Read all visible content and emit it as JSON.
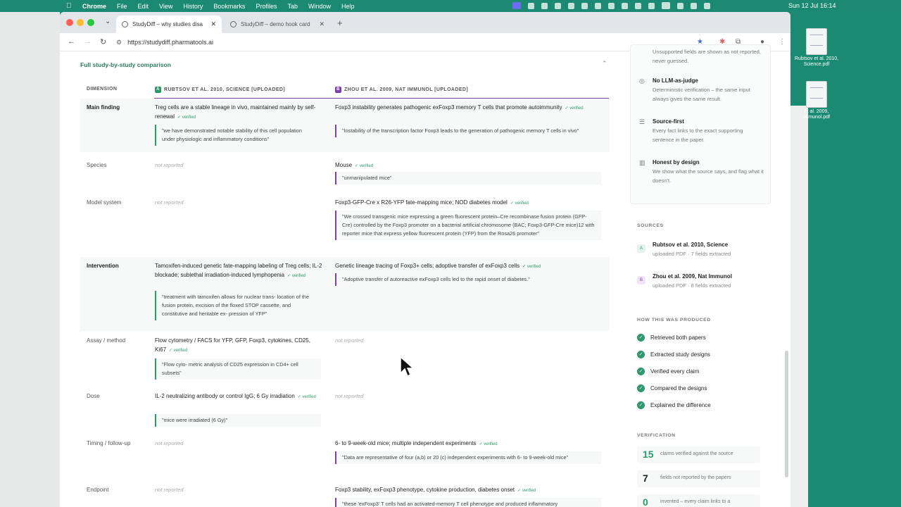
{
  "menubar": {
    "apple": "",
    "app_name": "Chrome",
    "menus": [
      "File",
      "Edit",
      "View",
      "History",
      "Bookmarks",
      "Profiles",
      "Tab",
      "Window",
      "Help"
    ],
    "clock": "Sun 12 Jul 16:14"
  },
  "desktop": {
    "files": [
      {
        "label": "Rubtsov et al. 2010, Science.pdf"
      },
      {
        "label": "et al. 2009, immunol.pdf"
      }
    ]
  },
  "browser": {
    "tabs": [
      {
        "label": "StudyDiff – why studies disa",
        "active": true
      },
      {
        "label": "StudyDiff – demo hook card",
        "active": false
      }
    ],
    "url": "https://studydiff.pharmatools.ai",
    "colors": {
      "accent_green": "#2b9a6a",
      "accent_purple": "#7e3fa8",
      "desktop_teal": "#1b8a72"
    }
  },
  "comparison": {
    "section_title": "Full study-by-study comparison",
    "headers": {
      "dimension": "DIMENSION",
      "study_a": "RUBTSOV ET AL. 2010, SCIENCE [UPLOADED]",
      "study_a_badge": "A",
      "study_b": "ZHOU ET AL. 2009, NAT IMMUNOL [UPLOADED]",
      "study_b_badge": "B"
    },
    "verified_label": "✓ verified",
    "not_reported": "not reported",
    "rows": [
      {
        "dimension": "Main finding",
        "a_value": "Treg cells are a stable lineage in vivo, maintained mainly by self-renewal",
        "a_quote": "\"we have demonstrated notable stability of this cell population under physiologic and inflammatory conditions\"",
        "b_value": "Foxp3 instability generates pathogenic exFoxp3 memory T cells that promote autoimmunity",
        "b_quote": "\"Instability of the transcription factor Foxp3 leads to the generation of pathogenic memory T cells in vivo\""
      },
      {
        "dimension": "Species",
        "a_value": "not reported",
        "b_value": "Mouse",
        "b_quote": "\"unmanipulated mice\""
      },
      {
        "dimension": "Model system",
        "a_value": "not reported",
        "b_value": "Foxp3-GFP-Cre x R26-YFP fate-mapping mice; NOD diabetes model",
        "b_quote": "\"We crossed transgenic mice expressing a green fluorescent protein–Cre recombinase fusion protein (GFP-Cre) controlled by the Foxp3 promoter on a bacterial artificial chromosome (BAC; Foxp3-GFP-Cre mice)12 with reporter mice that express yellow fluorescent protein (YFP) from the Rosa26 promoter\""
      },
      {
        "dimension": "Intervention",
        "a_value": "Tamoxifen-induced genetic fate-mapping labeling of Treg cells; IL-2 blockade; sublethal irradiation-induced lymphopenia",
        "a_quote": "\"treatment with tamoxifen allows for nuclear trans- location of the fusion protein, excision of the floxed STOP cassette, and constitutive and heritable ex- pression of YFP\"",
        "b_value": "Genetic lineage tracing of Foxp3+ cells; adoptive transfer of exFoxp3 cells",
        "b_quote": "\"Adoptive transfer of autoreactive exFoxp3 cells led to the rapid onset of diabetes.\""
      },
      {
        "dimension": "Assay / method",
        "a_value": "Flow cytometry / FACS for YFP, GFP, Foxp3, cytokines, CD25, Ki67",
        "a_quote": "\"Flow cyto- metric analysis of CD25 expression in CD4+ cell subsets\"",
        "b_value": "not reported"
      },
      {
        "dimension": "Dose",
        "a_value": "IL-2 neutralizing antibody or control IgG; 6 Gy irradiation",
        "a_quote": "\"mice were irradiated (6 Gy)\"",
        "b_value": "not reported"
      },
      {
        "dimension": "Timing / follow-up",
        "a_value": "not reported",
        "b_value": "6- to 9-week-old mice; multiple independent experiments",
        "b_quote": "\"Data are representative of four (a,b) or 20 (c) independent experiments with 6- to 9-week-old mice\""
      },
      {
        "dimension": "Endpoint",
        "a_value": "not reported",
        "b_value": "Foxp3 stability, exFoxp3 phenotype, cytokine production, diabetes onset",
        "b_quote": "\"these 'exFoxp3' T cells had an activated-memory T cell phenotype and produced inflammatory"
      }
    ]
  },
  "sidebar": {
    "principles_top_text": "Unsupported fields are shown as not reported, never guessed.",
    "principles": [
      {
        "icon": "◎",
        "title": "No LLM-as-judge",
        "desc": "Deterministic verification – the same input always gives the same result."
      },
      {
        "icon": "☰",
        "title": "Source-first",
        "desc": "Every fact links to the exact supporting sentence in the paper."
      },
      {
        "icon": "▥",
        "title": "Honest by design",
        "desc": "We show what the source says, and flag what it doesn't."
      }
    ],
    "sources_label": "SOURCES",
    "sources": [
      {
        "badge": "A",
        "title": "Rubtsov et al. 2010, Science",
        "sub": "uploaded PDF · 7 fields extracted"
      },
      {
        "badge": "B",
        "title": "Zhou et al. 2009, Nat Immunol",
        "sub": "uploaded PDF · 8 fields extracted"
      }
    ],
    "how_label": "HOW THIS WAS PRODUCED",
    "steps": [
      "Retrieved both papers",
      "Extracted study designs",
      "Verified every claim",
      "Compared the designs",
      "Explained the difference"
    ],
    "verification_label": "VERIFICATION",
    "stats": [
      {
        "num": "15",
        "label": "claims verified against the source"
      },
      {
        "num": "7",
        "label": "fields not reported by the papers"
      },
      {
        "num": "0",
        "label": "invented – every claim links to a"
      }
    ]
  }
}
